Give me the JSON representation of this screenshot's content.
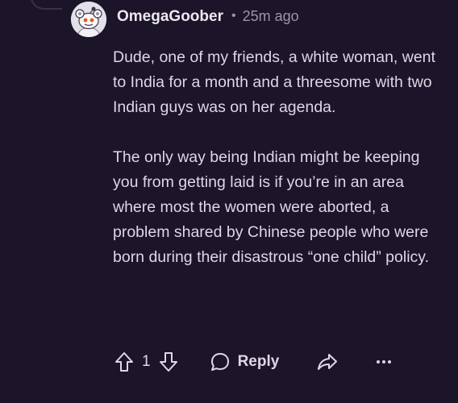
{
  "comment": {
    "author": "OmegaGoober",
    "separator": "•",
    "timestamp": "25m ago",
    "paragraphs": [
      "Dude, one of my friends, a white woman, went to India for a month and a threesome with two Indian guys was on her agenda.",
      "The only way being Indian might be keeping you from getting laid is if you’re in an area where most the women were aborted, a problem shared by Chinese people who were born during their disastrous “one child” policy."
    ]
  },
  "actions": {
    "vote_count": "1",
    "reply_label": "Reply",
    "icons": [
      "upvote-icon",
      "downvote-icon",
      "reply-icon",
      "share-icon",
      "more-icon"
    ]
  },
  "colors": {
    "background": "#1c1428",
    "text": "#ddd7e6",
    "muted": "#9d93ab"
  }
}
